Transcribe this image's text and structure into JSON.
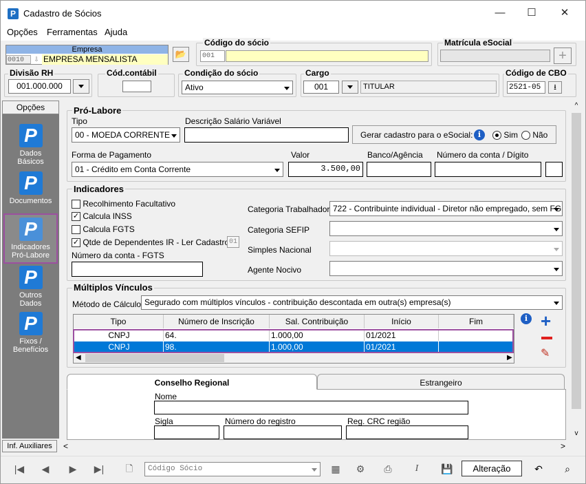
{
  "window": {
    "title": "Cadastro de Sócios",
    "minimize": "—",
    "maximize": "☐",
    "close": "✕"
  },
  "menu": [
    "Opções",
    "Ferramentas",
    "Ajuda"
  ],
  "empresa": {
    "label": "Empresa",
    "code": "0010",
    "name": "EMPRESA MENSALISTA"
  },
  "codigo_socio": {
    "label": "Código do sócio",
    "value": "001"
  },
  "matricula": {
    "label": "Matrícula eSocial",
    "value": ""
  },
  "divisao": {
    "label": "Divisão RH",
    "value": "001.000.000"
  },
  "cod_contabil": {
    "label": "Cód.contábil",
    "value": ""
  },
  "condicao": {
    "label": "Condição do sócio",
    "value": "Ativo"
  },
  "cargo": {
    "label": "Cargo",
    "code": "001",
    "name": "TITULAR"
  },
  "cbo": {
    "label": "Código de CBO",
    "value": "2521-05"
  },
  "sidebar": {
    "header": "Opções",
    "items": [
      {
        "label": "Dados Básicos",
        "icon": "P"
      },
      {
        "label": "Documentos",
        "icon": "P"
      },
      {
        "label": "Indicadores Pró-Labore",
        "icon": "P"
      },
      {
        "label": "Outros Dados",
        "icon": "P"
      },
      {
        "label": "Fixos / Benefícios",
        "icon": "P"
      }
    ],
    "footer": "Inf. Auxiliares"
  },
  "pro_labore": {
    "title": "Pró-Labore",
    "tipo_label": "Tipo",
    "tipo_value": "00 - MOEDA CORRENTE",
    "desc_label": "Descrição Salário Variável",
    "desc_value": "",
    "esocial_label": "Gerar cadastro para o eSocial:",
    "sim": "Sim",
    "nao": "Não",
    "forma_label": "Forma de Pagamento",
    "forma_value": "01 - Crédito em Conta Corrente",
    "valor_label": "Valor",
    "valor_value": "3.500,00",
    "banco_label": "Banco/Agência",
    "conta_label": "Número da conta / Dígito"
  },
  "indicadores": {
    "title": "Indicadores",
    "recolhimento": "Recolhimento Facultativo",
    "inss": "Calcula INSS",
    "fgts": "Calcula FGTS",
    "dependentes": "Qtde de Dependentes IR - Ler Cadastro",
    "dependentes_value": "01",
    "conta_fgts_label": "Número da conta - FGTS",
    "cat_trab_label": "Categoria Trabalhador",
    "cat_trab_value": "722 - Contribuinte individual - Diretor não empregado, sem FG",
    "sefip_label": "Categoria SEFIP",
    "simples_label": "Simples Nacional",
    "agente_label": "Agente Nocivo"
  },
  "multiplos": {
    "title": "Múltiplos Vínculos",
    "metodo_label": "Método de Cálculo",
    "metodo_value": "Segurado com múltiplos vínculos - contribuição descontada em outra(s) empresa(s)",
    "columns": [
      "Tipo",
      "Número de Inscrição",
      "Sal. Contribuição",
      "Início",
      "Fim"
    ],
    "rows": [
      [
        "CNPJ",
        "64.",
        "1.000,00",
        "01/2021",
        ""
      ],
      [
        "CNPJ",
        "98.",
        "1.000,00",
        "01/2021",
        ""
      ]
    ]
  },
  "tabs": {
    "conselho": "Conselho Regional",
    "estrangeiro": "Estrangeiro"
  },
  "conselho": {
    "nome_label": "Nome",
    "sigla_label": "Sigla",
    "registro_label": "Número do registro",
    "crc_label": "Reg. CRC região"
  },
  "bottom": {
    "search_placeholder": "Código Sócio",
    "mode": "Alteração"
  },
  "colors": {
    "accent": "#1e6fc3",
    "selection": "#0078d7",
    "highlight_outline": "#9c4fa0",
    "sidebar": "#7c7c7c",
    "yellow_field": "#ffffc0"
  }
}
